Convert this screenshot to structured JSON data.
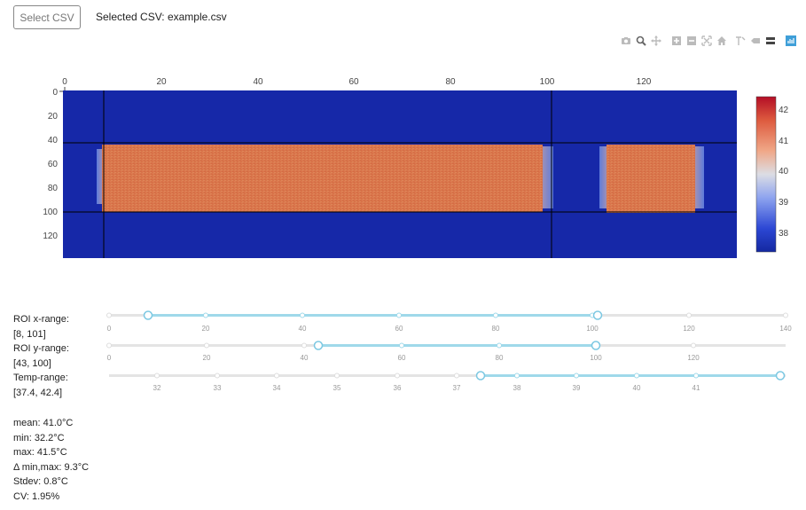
{
  "header": {
    "select_button": "Select CSV",
    "selected_label": "Selected CSV:",
    "selected_file": "example.csv"
  },
  "toolbar": {
    "icons": [
      "camera-icon",
      "zoom-icon",
      "pan-icon",
      "zoom-in-icon",
      "zoom-out-icon",
      "autoscale-icon",
      "reset-axes-icon",
      "spike-lines-icon",
      "hover-closest-icon",
      "hover-compare-icon",
      "plotly-logo-icon"
    ]
  },
  "heatmap": {
    "x_ticks": [
      "0",
      "20",
      "40",
      "60",
      "80",
      "100",
      "120"
    ],
    "y_ticks": [
      "0",
      "20",
      "40",
      "60",
      "80",
      "100",
      "120"
    ],
    "colorbar_ticks": [
      "42",
      "41",
      "40",
      "39",
      "38"
    ],
    "colors": {
      "background": "#1628a8",
      "hot": "#d9744a",
      "grid_line": "#000000"
    }
  },
  "controls": {
    "roi_x": {
      "label": "ROI x-range:",
      "value": "[8, 101]",
      "ticks": [
        "0",
        "20",
        "40",
        "60",
        "80",
        "100",
        "120",
        "140"
      ]
    },
    "roi_y": {
      "label": "ROI y-range:",
      "value": "[43, 100]",
      "ticks": [
        "0",
        "20",
        "40",
        "60",
        "80",
        "100",
        "120"
      ]
    },
    "temp": {
      "label": "Temp-range:",
      "value": "[37.4, 42.4]",
      "ticks": [
        "32",
        "33",
        "34",
        "35",
        "36",
        "37",
        "38",
        "39",
        "40",
        "41"
      ]
    }
  },
  "stats": {
    "mean": "mean: 41.0°C",
    "min": "min: 32.2°C",
    "max": "max: 41.5°C",
    "delta": "Δ min,max: 9.3°C",
    "stdev": "Stdev: 0.8°C",
    "cv": "CV: 1.95%"
  }
}
